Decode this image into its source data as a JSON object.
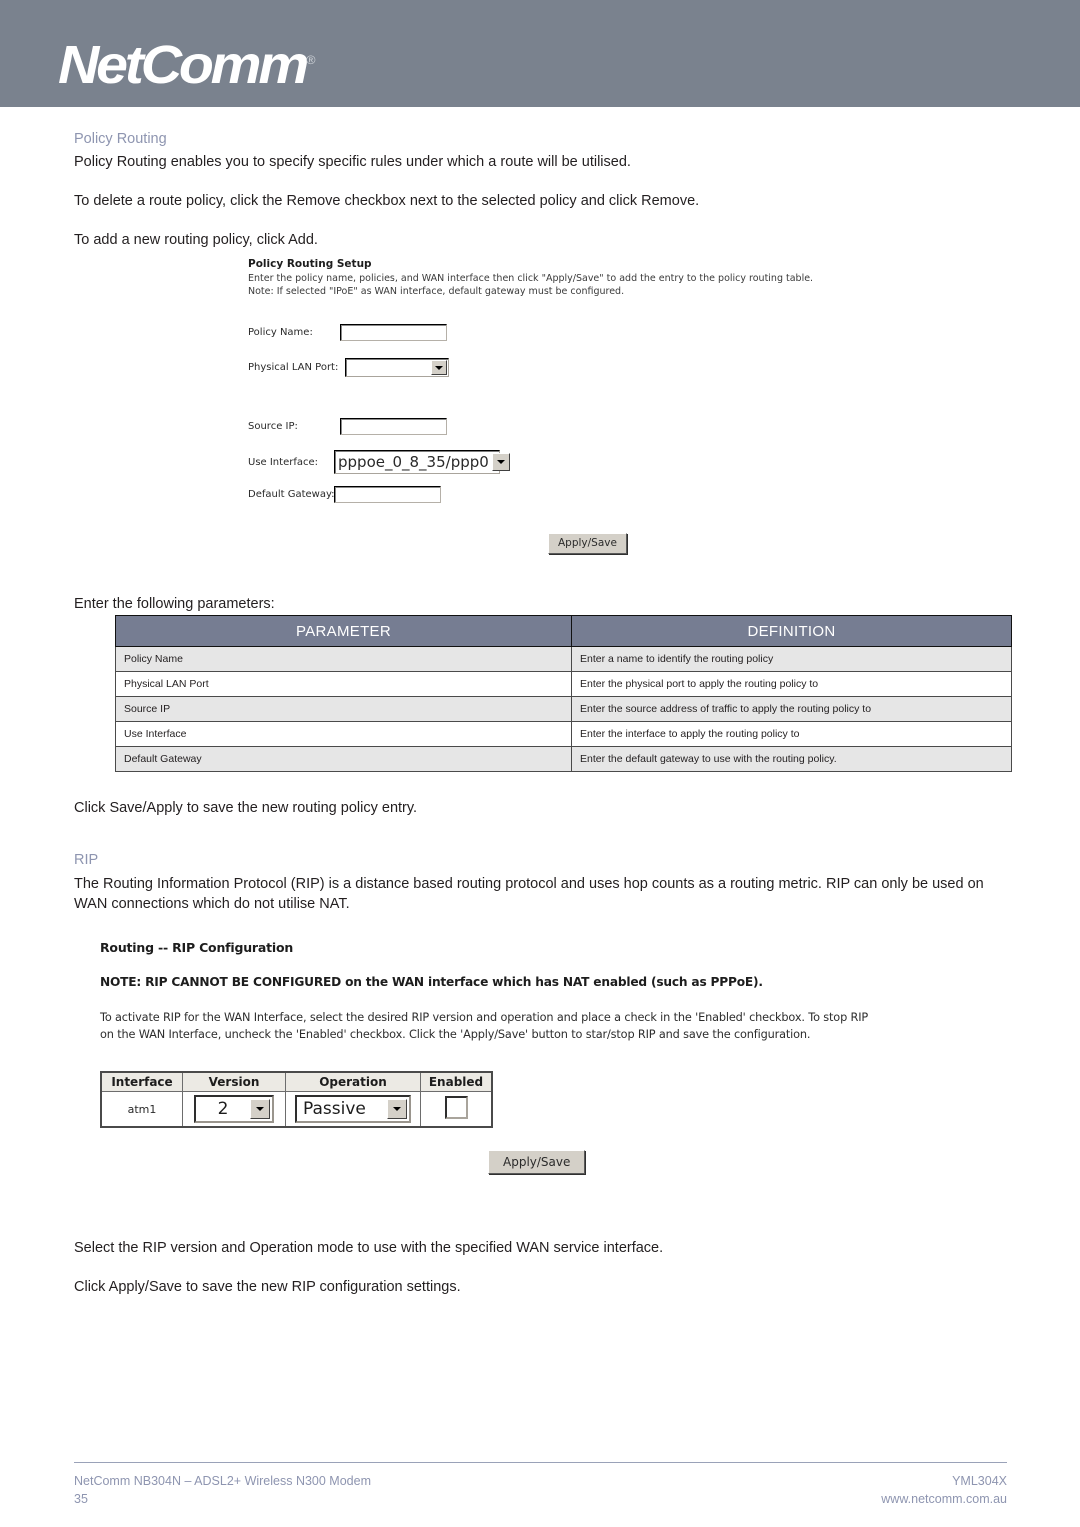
{
  "header": {
    "logo_text": "NetComm",
    "logo_mark": "®",
    "band_color": "#7a828e"
  },
  "section1": {
    "heading": "Policy Routing",
    "p1": "Policy Routing enables you to specify specific rules under which a route will be utilised.",
    "p2": "To delete a route policy, click the Remove checkbox next to the selected policy and click Remove.",
    "p3": "To add a new routing policy, click Add.",
    "p4": "Enter the following parameters:",
    "p5": "Click Save/Apply to save the new routing policy entry."
  },
  "policy_shot": {
    "title": "Policy Routing Setup",
    "note_line1": "Enter the policy name, policies, and WAN interface then click \"Apply/Save\" to add the entry to the policy routing table.",
    "note_line2": "Note: If selected \"IPoE\" as WAN interface, default gateway must be configured.",
    "fields": [
      {
        "label": "Policy Name:",
        "value": "",
        "control": "text"
      },
      {
        "label": "Physical LAN Port:",
        "value": "",
        "control": "select"
      },
      {
        "label": "Source IP:",
        "value": "",
        "control": "text"
      },
      {
        "label": "Use Interface:",
        "value": "pppoe_0_8_35/ppp0",
        "control": "select"
      },
      {
        "label": "Default Gateway:",
        "value": "",
        "control": "text"
      }
    ],
    "button_label": "Apply/Save"
  },
  "param_table": {
    "columns": [
      "PARAMETER",
      "DEFINITION"
    ],
    "rows": [
      [
        "Policy Name",
        "Enter a name to identify the routing policy"
      ],
      [
        "Physical LAN Port",
        "Enter the physical port to apply the routing policy to"
      ],
      [
        "Source IP",
        "Enter the source address of traffic to apply the routing policy to"
      ],
      [
        "Use Interface",
        "Enter the interface to apply the routing policy to"
      ],
      [
        "Default Gateway",
        "Enter the default gateway to use with the routing policy."
      ]
    ],
    "header_color": "#767d92",
    "alt_row_color": "#e6e6e6"
  },
  "section2": {
    "heading": "RIP",
    "p1": "The Routing Information Protocol (RIP) is a distance based routing protocol and uses hop counts as a routing metric. RIP can only be used on WAN connections which do not utilise NAT.",
    "p2": "Select the RIP version and Operation mode to use with the specified WAN service interface.",
    "p3": "Click Apply/Save to save the new RIP configuration settings."
  },
  "rip_shot": {
    "title": "Routing -- RIP Configuration",
    "note": "NOTE: RIP CANNOT BE CONFIGURED on the WAN interface which has NAT enabled (such as PPPoE).",
    "body_line1": "To activate RIP for the WAN Interface, select the desired RIP version and operation and place a check in the 'Enabled' checkbox. To stop RIP",
    "body_line2": "on the WAN Interface, uncheck the 'Enabled' checkbox. Click the 'Apply/Save' button to star/stop RIP and save the configuration.",
    "columns": [
      "Interface",
      "Version",
      "Operation",
      "Enabled"
    ],
    "row": {
      "interface": "atm1",
      "version": "2",
      "operation": "Passive",
      "enabled": false
    },
    "button_label": "Apply/Save"
  },
  "footer": {
    "product": "NetComm NB304N – ADSL2+ Wireless N300 Modem",
    "page_number": "35",
    "doc_code": "YML304X",
    "website": "www.netcomm.com.au",
    "text_color": "#8e95b0"
  }
}
